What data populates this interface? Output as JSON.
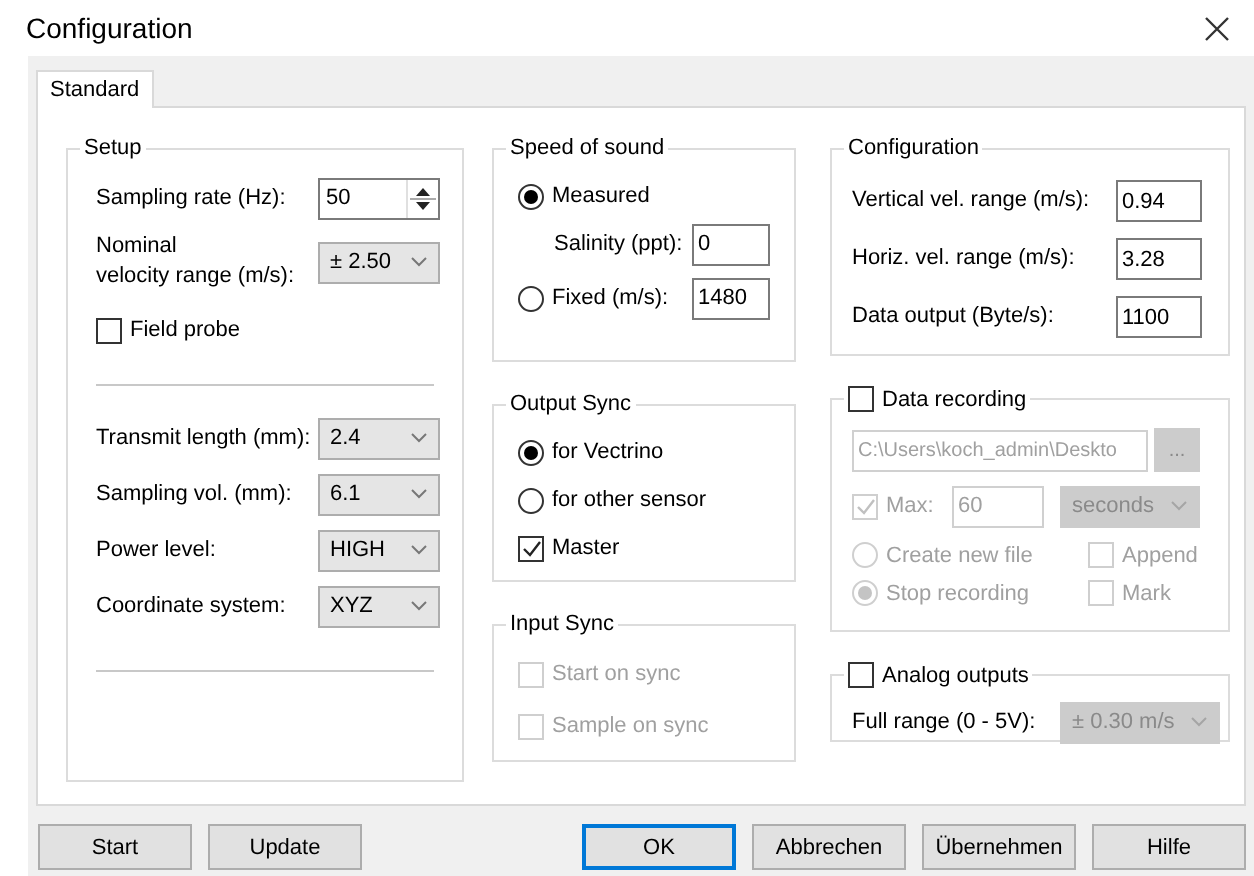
{
  "window": {
    "title": "Configuration"
  },
  "tabs": [
    {
      "label": "Standard",
      "selected": true
    }
  ],
  "setup": {
    "title": "Setup",
    "sampling_rate": {
      "label": "Sampling rate (Hz):",
      "value": "50"
    },
    "velocity_range": {
      "label": "Nominal\nvelocity range (m/s):",
      "value": "± 2.50"
    },
    "field_probe": {
      "label": "Field probe",
      "checked": false
    },
    "selects": [
      {
        "label": "Transmit length (mm):",
        "value": "2.4"
      },
      {
        "label": "Sampling vol. (mm):",
        "value": "6.1"
      },
      {
        "label": "Power level:",
        "value": "HIGH"
      },
      {
        "label": "Coordinate system:",
        "value": "XYZ"
      }
    ]
  },
  "speed_of_sound": {
    "title": "Speed of sound",
    "measured": {
      "label": "Measured",
      "selected": true
    },
    "salinity": {
      "label": "Salinity (ppt):",
      "value": "0"
    },
    "fixed": {
      "label": "Fixed (m/s):",
      "selected": false,
      "value": "1480"
    }
  },
  "output_sync": {
    "title": "Output Sync",
    "options": [
      {
        "label": "for Vectrino",
        "selected": true
      },
      {
        "label": "for other sensor",
        "selected": false
      }
    ],
    "master": {
      "label": "Master",
      "checked": true
    }
  },
  "input_sync": {
    "title": "Input Sync",
    "disabled": true,
    "options": [
      {
        "label": "Start on sync",
        "checked": false
      },
      {
        "label": "Sample on sync",
        "checked": false
      }
    ]
  },
  "configuration": {
    "title": "Configuration",
    "fields": [
      {
        "label": "Vertical vel. range (m/s):",
        "value": "0.94"
      },
      {
        "label": "Horiz. vel. range (m/s):",
        "value": "3.28"
      },
      {
        "label": "Data output (Byte/s):",
        "value": "1100"
      }
    ]
  },
  "data_recording": {
    "label": "Data recording",
    "checked": false,
    "disabled": true,
    "path": "C:\\Users\\koch_admin\\Deskto",
    "browse": "...",
    "max": {
      "label": "Max:",
      "checked": true,
      "value": "60",
      "unit": "seconds"
    },
    "modes": [
      {
        "label": "Create new file",
        "selected": false
      },
      {
        "label": "Stop recording",
        "selected": true
      }
    ],
    "flags": [
      {
        "label": "Append",
        "checked": false
      },
      {
        "label": "Mark",
        "checked": false
      }
    ]
  },
  "analog_outputs": {
    "label": "Analog outputs",
    "checked": false,
    "full_range": {
      "label": "Full range (0 - 5V):",
      "value": "± 0.30 m/s",
      "disabled": true
    }
  },
  "left_buttons": [
    {
      "label": "Start",
      "default": false
    },
    {
      "label": "Update",
      "default": false
    }
  ],
  "right_buttons": [
    {
      "label": "OK",
      "default": true
    },
    {
      "label": "Abbrechen",
      "default": false
    },
    {
      "label": "Übernehmen",
      "default": false
    },
    {
      "label": "Hilfe",
      "default": false
    }
  ]
}
